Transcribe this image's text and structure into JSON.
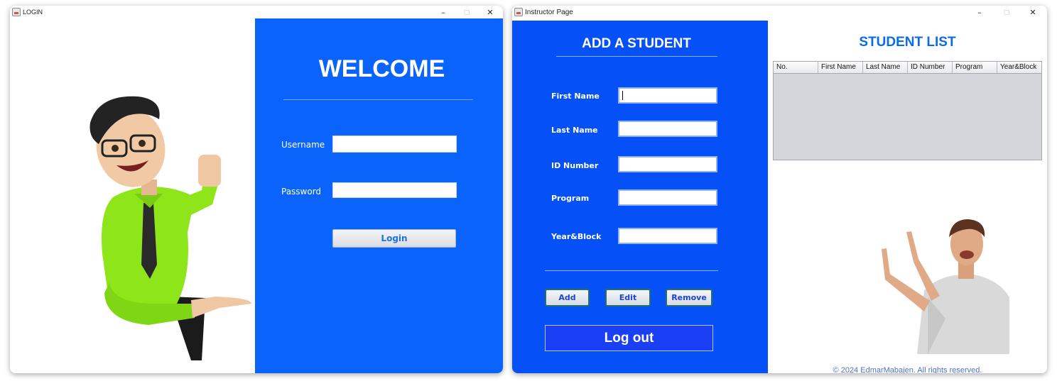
{
  "login_window": {
    "title": "LOGIN",
    "welcome": "WELCOME",
    "username_label": "Username",
    "password_label": "Password",
    "username_value": "",
    "password_value": "",
    "login_button": "Login",
    "accent": "#0a63fb"
  },
  "instructor_window": {
    "title": "Instructor Page",
    "form_title": "ADD A STUDENT",
    "fields": {
      "first_name": "First Name",
      "last_name": "Last Name",
      "id_number": "ID Number",
      "program": "Program",
      "year_block": "Year&Block"
    },
    "buttons": {
      "add": "Add",
      "edit": "Edit",
      "remove": "Remove",
      "logout": "Log out"
    },
    "list_title": "STUDENT LIST",
    "table": {
      "columns": [
        "No.",
        "First Name",
        "Last Name",
        "ID Number",
        "Program",
        "Year&Block"
      ],
      "rows": []
    },
    "footer": "© 2024 EdmarMabajen. All rights reserved.",
    "accent": "#0550f7"
  },
  "window_controls": {
    "minimize": "–",
    "maximize": "□",
    "close": "✕"
  }
}
